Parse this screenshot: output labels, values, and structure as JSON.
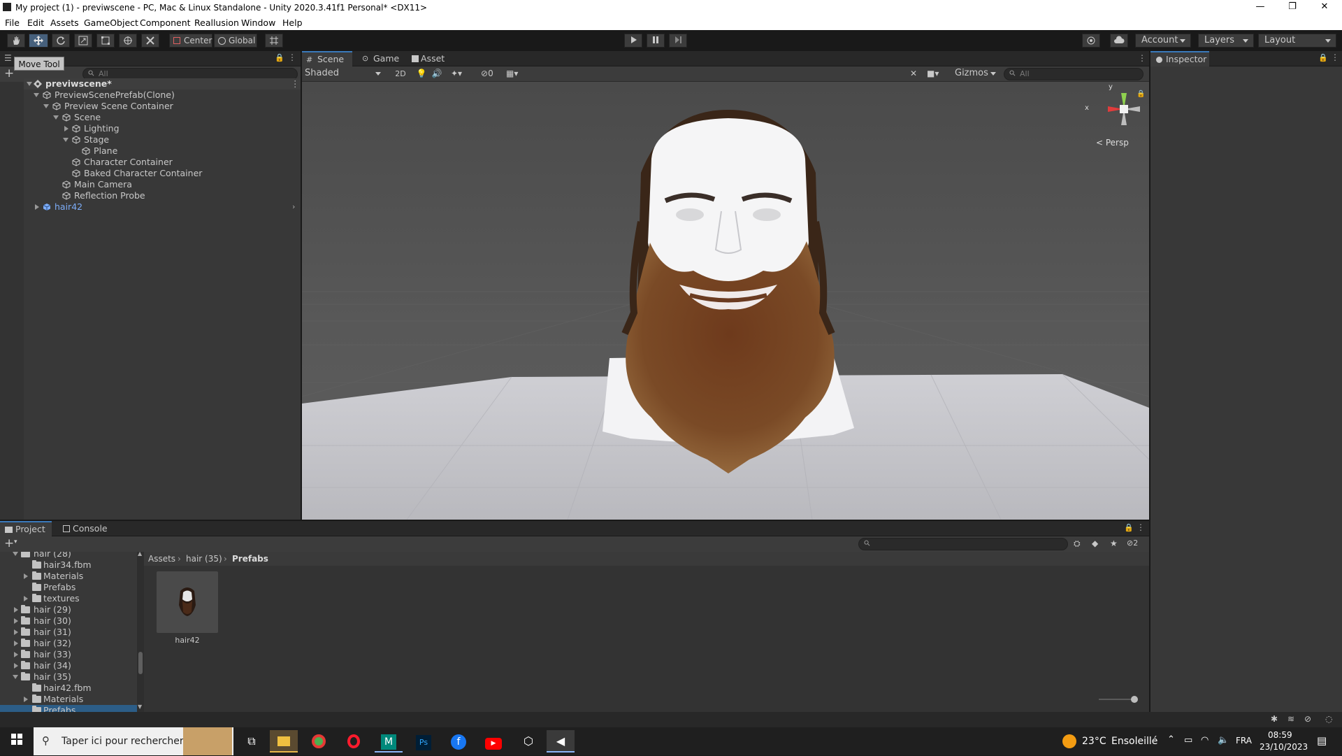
{
  "window": {
    "title": "My project (1) - previwscene - PC, Mac & Linux Standalone - Unity 2020.3.41f1 Personal* <DX11>",
    "minimize": "—",
    "restore": "❐",
    "close": "✕"
  },
  "menu": [
    "File",
    "Edit",
    "Assets",
    "GameObject",
    "Component",
    "Reallusion",
    "Window",
    "Help"
  ],
  "toolbar": {
    "pivot": "Center",
    "space": "Global",
    "account": "Account",
    "layers": "Layers",
    "layout": "Layout",
    "tooltip": "Move Tool"
  },
  "hierarchy": {
    "search_placeholder": "All",
    "scene": "previwscene*",
    "items": [
      {
        "label": "PreviewScenePrefab(Clone)"
      },
      {
        "label": "Preview Scene Container"
      },
      {
        "label": "Scene"
      },
      {
        "label": "Lighting"
      },
      {
        "label": "Stage"
      },
      {
        "label": "Plane"
      },
      {
        "label": "Character Container"
      },
      {
        "label": "Baked Character Container"
      },
      {
        "label": "Main Camera"
      },
      {
        "label": "Reflection Probe"
      },
      {
        "label": "hair42"
      }
    ]
  },
  "scene_view": {
    "tabs": [
      "Scene",
      "Game",
      "Asset Store"
    ],
    "shading": "Shaded",
    "mode_2d": "2D",
    "hidden_count": "0",
    "gizmos": "Gizmos",
    "search_placeholder": "All",
    "axis_x": "x",
    "axis_y": "y",
    "projection": "< Persp"
  },
  "inspector": {
    "tab": "Inspector"
  },
  "project": {
    "tabs": [
      "Project",
      "Console"
    ],
    "badge_count": "2",
    "breadcrumb": [
      "Assets",
      "hair (35)",
      "Prefabs"
    ],
    "tree": [
      {
        "label": "hair (28)"
      },
      {
        "label": "hair34.fbm"
      },
      {
        "label": "Materials"
      },
      {
        "label": "Prefabs"
      },
      {
        "label": "textures"
      },
      {
        "label": "hair (29)"
      },
      {
        "label": "hair (30)"
      },
      {
        "label": "hair (31)"
      },
      {
        "label": "hair (32)"
      },
      {
        "label": "hair (33)"
      },
      {
        "label": "hair (34)"
      },
      {
        "label": "hair (35)"
      },
      {
        "label": "hair42.fbm"
      },
      {
        "label": "Materials"
      },
      {
        "label": "Prefabs"
      }
    ],
    "asset": "hair42"
  },
  "taskbar": {
    "search_placeholder": "Taper ici pour rechercher",
    "weather_temp": "23°C",
    "weather_desc": "Ensoleillé",
    "language": "FRA",
    "time": "08:59",
    "date": "23/10/2023"
  },
  "colors": {
    "accent": "#3a79bb",
    "panel": "#383838",
    "scene_bg": "#4c4c4c",
    "prefab_blue": "#7cacf7"
  }
}
